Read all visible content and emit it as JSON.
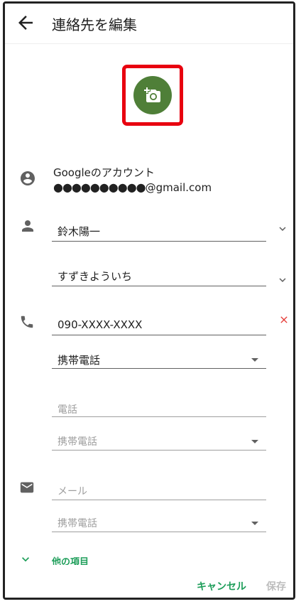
{
  "header": {
    "title": "連絡先を編集",
    "back_icon": "arrow-back-icon"
  },
  "photo": {
    "icon": "add-photo-icon",
    "color": "#4f7f38",
    "highlight_color": "#e8000f"
  },
  "account": {
    "label": "Googleのアカウント",
    "masked": "●●●●●●●●●●",
    "domain": "@gmail.com",
    "icon": "account-circle-icon"
  },
  "name": {
    "value": "鈴木陽一",
    "reading": "すずきよういち",
    "icon": "person-icon"
  },
  "phone": {
    "value": "090-XXXX-XXXX",
    "type": "携帯電話",
    "placeholder": "電話",
    "placeholder_type": "携帯電話",
    "icon": "phone-icon",
    "clear_icon": "close-icon"
  },
  "email": {
    "placeholder": "メール",
    "type": "携帯電話",
    "icon": "mail-icon"
  },
  "more": {
    "label": "他の項目"
  },
  "actions": {
    "cancel": "キャンセル",
    "save": "保存"
  },
  "colors": {
    "accent": "#1e9e5a",
    "clear": "#e53935"
  }
}
